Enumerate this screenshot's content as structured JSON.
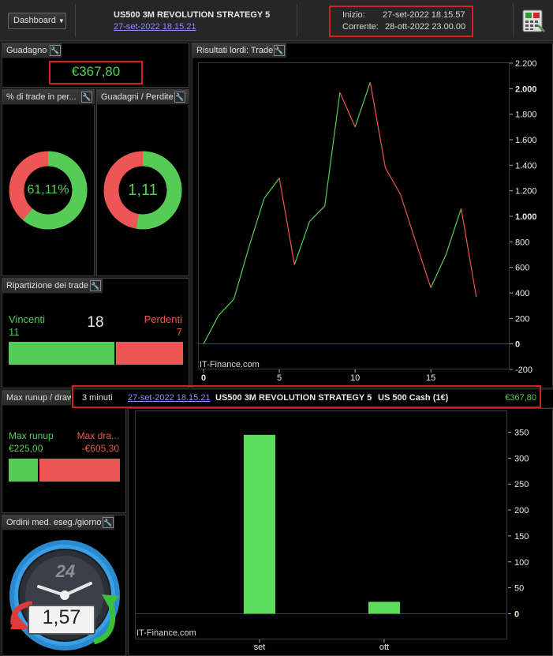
{
  "header": {
    "dashboard_label": "Dashboard",
    "strategy_title": "US500 3M REVOLUTION STRATEGY 5",
    "strategy_date": "27-set-2022 18.15.21",
    "inizio_label": "Inizio:",
    "inizio_value": "27-set-2022 18.15.57",
    "corrente_label": "Corrente:",
    "corrente_value": "28-ott-2022 23.00.00"
  },
  "guadagno": {
    "title": "Guadagno",
    "value": "€367,80"
  },
  "pct_trade": {
    "title": "% di trade in per...",
    "value": "61,11%",
    "fraction_win": 0.6111
  },
  "guadagni_perdite": {
    "title": "Guadagni / Perdite",
    "value": "1,11",
    "fraction_win": 0.526
  },
  "ripartizione": {
    "title": "Ripartizione dei trade",
    "vincenti_label": "Vincenti",
    "vincenti_count": "11",
    "total": "18",
    "perdenti_label": "Perdenti",
    "perdenti_count": "7",
    "win_fraction": 0.6111
  },
  "runup": {
    "title": "Max runup / draw",
    "runup_label": "Max runup",
    "runup_value": "€225,00",
    "draw_label": "Max dra...",
    "draw_value": "-€605,30",
    "runup_fraction": 0.27
  },
  "ordini": {
    "title": "Ordini med. eseg./giorno",
    "clock_label": "24",
    "value": "1,57"
  },
  "info_bar": {
    "timeframe": "3 minuti",
    "date": "27-set-2022 18.15.21",
    "strategy": "US500 3M REVOLUTION STRATEGY 5",
    "instrument": "US 500 Cash (1€)",
    "value": "€367,80"
  },
  "watermark": "IT-Finance.com",
  "colors": {
    "green": "#55cc55",
    "red": "#ee5555",
    "zero_line": "#3535c8",
    "bar": "#5ddc5d"
  },
  "chart_data": [
    {
      "type": "line",
      "title": "Risultati lordi: Trade",
      "x": [
        0,
        1,
        2,
        3,
        4,
        5,
        6,
        7,
        8,
        9,
        10,
        11,
        12,
        13,
        14,
        15,
        16,
        17,
        18
      ],
      "y": [
        0,
        225,
        350,
        760,
        1140,
        1300,
        620,
        960,
        1080,
        1970,
        1700,
        2050,
        1380,
        1170,
        800,
        440,
        700,
        1060,
        368
      ],
      "xticks": [
        "0",
        "5",
        "10",
        "15"
      ],
      "yticks": [
        "2.200",
        "2.000",
        "1.800",
        "1.600",
        "1.400",
        "1.200",
        "1.000",
        "800",
        "600",
        "400",
        "200",
        "0",
        "-200"
      ],
      "ylim": [
        -200,
        2200
      ],
      "xlim": [
        0,
        19
      ]
    },
    {
      "type": "bar",
      "categories": [
        "set",
        "ott"
      ],
      "values": [
        345,
        23
      ],
      "yticks": [
        "350",
        "300",
        "250",
        "200",
        "150",
        "100",
        "50",
        "0"
      ],
      "ylim": [
        -10,
        360
      ]
    }
  ]
}
